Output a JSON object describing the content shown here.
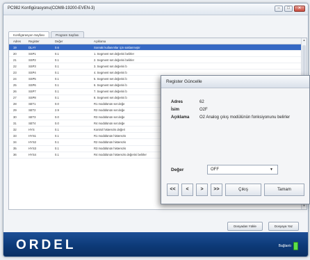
{
  "window": {
    "title": "PC982 Konfigürasyonu(COM8-19200-EVEN-3)",
    "controls": [
      "–",
      "□",
      "✕"
    ]
  },
  "tabs": [
    {
      "label": "Konfigürasyon Sayfası",
      "active": true
    },
    {
      "label": "Program Sayfası",
      "active": false
    }
  ],
  "table": {
    "headers": [
      "Adres",
      "Register",
      "Değer",
      "Açıklama"
    ],
    "rows": [
      {
        "adres": "19",
        "register": "DLAY",
        "deger": "0.6",
        "aciklama": "Sonraki kullanımlar için saklanmıştır",
        "selected": true
      },
      {
        "adres": "20",
        "register": "SSP1",
        "deger": "0.1",
        "aciklama": "1. Segment set değerini belirler"
      },
      {
        "adres": "21",
        "register": "SSP2",
        "deger": "0.1",
        "aciklama": "2. Segment set değerini belirler"
      },
      {
        "adres": "22",
        "register": "SSP3",
        "deger": "0.1",
        "aciklama": "3. Segment set değerini b"
      },
      {
        "adres": "23",
        "register": "SSP4",
        "deger": "0.1",
        "aciklama": "4. Segment set değerini b"
      },
      {
        "adres": "24",
        "register": "SSP5",
        "deger": "0.1",
        "aciklama": "5. Segment set değerini b"
      },
      {
        "adres": "25",
        "register": "SSP6",
        "deger": "0.1",
        "aciklama": "6. Segment set değerini b"
      },
      {
        "adres": "26",
        "register": "SSP7",
        "deger": "0.1",
        "aciklama": "7. Segment set değerini b"
      },
      {
        "adres": "27",
        "register": "SSP8",
        "deger": "0.1",
        "aciklama": "8. Segment set değerini b"
      },
      {
        "adres": "28",
        "register": "SET1",
        "deger": "0.0",
        "aciklama": "R1 modülünün set değe"
      },
      {
        "adres": "29",
        "register": "SET2",
        "deger": "2.9",
        "aciklama": "R2 modülünün set değe"
      },
      {
        "adres": "30",
        "register": "SET3",
        "deger": "0.0",
        "aciklama": "R3 modülünün set değe"
      },
      {
        "adres": "31",
        "register": "SET4",
        "deger": "0.0",
        "aciklama": "R4 modülünün set değe"
      },
      {
        "adres": "32",
        "register": "HYS",
        "deger": "0.1",
        "aciklama": "Kontrol histerezis değeri"
      },
      {
        "adres": "33",
        "register": "HYS1",
        "deger": "0.1",
        "aciklama": "R1 modülünün histerezis"
      },
      {
        "adres": "34",
        "register": "HYS2",
        "deger": "0.1",
        "aciklama": "R2 modülünün histerezis"
      },
      {
        "adres": "35",
        "register": "HYS3",
        "deger": "0.1",
        "aciklama": "R3 modülünün histerezis"
      },
      {
        "adres": "36",
        "register": "HYS4",
        "deger": "0.1",
        "aciklama": "R4 modülünün histerezis değerini belirler"
      }
    ]
  },
  "buttons": {
    "load": "Dosyadan Yükle",
    "save": "Dosyaya Yaz"
  },
  "footer": {
    "logo": "ORDEL",
    "status": "Bağlantı"
  },
  "dialog": {
    "title": "Register Güncelle",
    "adres_label": "Adres",
    "adres_value": "62",
    "isim_label": "İsim",
    "isim_value": "O2F",
    "aciklama_label": "Açıklama",
    "aciklama_value": "O2 Analog çıkış modülünün fonksiyonunu belirler",
    "deger_label": "Değer",
    "deger_value": "OFF",
    "nav": {
      "first": "<<",
      "prev": "<",
      "next": ">",
      "last": ">>"
    },
    "exit_label": "Çıkış",
    "ok_label": "Tamam"
  },
  "colors": {
    "selected_row": "#3568c4",
    "footer_bg": "#0d3a78",
    "status_led": "#5ce04a"
  }
}
